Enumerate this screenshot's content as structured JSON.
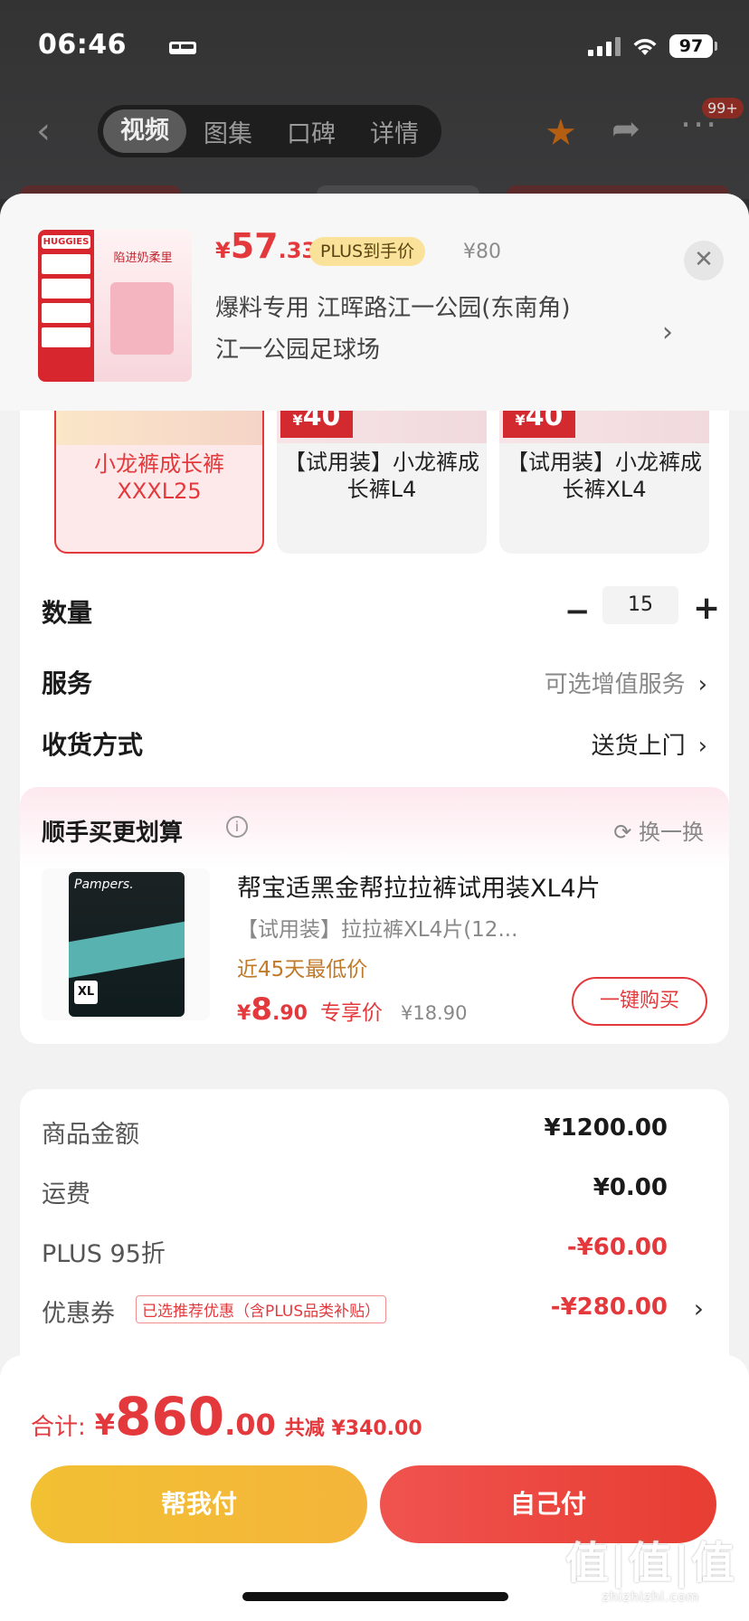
{
  "status": {
    "time": "06:46",
    "battery": "97"
  },
  "nav": {
    "back": "‹",
    "tabs": [
      "视频",
      "图集",
      "口碑",
      "详情"
    ],
    "active_tab": 0,
    "badge": "99+"
  },
  "product": {
    "price_yen": "¥",
    "price_int": "57",
    "price_dec": ".33",
    "plus_label": "PLUS到手价",
    "old_price": "¥80",
    "address_line1": "爆料专用  江晖路江一公园(东南角)",
    "address_line2": "江一公园足球场",
    "thumb_text": "陷进奶柔里",
    "thumb_brand": "HUGGIES"
  },
  "variants": [
    {
      "name": "小龙裤成长裤XXXL25",
      "tag": "",
      "selected": true
    },
    {
      "name": "【试用装】小龙裤成长裤L4",
      "tag": "40",
      "selected": false
    },
    {
      "name": "【试用装】小龙裤成长裤XL4",
      "tag": "40",
      "selected": false
    }
  ],
  "rows": {
    "quantity_label": "数量",
    "quantity_value": "15",
    "service_label": "服务",
    "service_value": "可选增值服务",
    "delivery_label": "收货方式",
    "delivery_value": "送货上门"
  },
  "recommend": {
    "title": "顺手买更划算",
    "swap": "换一换",
    "item_title": "帮宝适黑金帮拉拉裤试用装XL4片",
    "item_sub": "【试用装】拉拉裤XL4片(12...",
    "item_low": "近45天最低价",
    "price_yen": "¥",
    "price_int": "8",
    "price_dec": ".90",
    "price_tag": "专享价",
    "old_price": "¥18.90",
    "buy_label": "一键购买",
    "img_brand": "Pampers.",
    "img_size": "XL"
  },
  "summary": {
    "goods_label": "商品金额",
    "goods_value": "¥1200.00",
    "freight_label": "运费",
    "freight_value": "¥0.00",
    "plus_label": "PLUS 95折",
    "plus_value": "-¥60.00",
    "coupon_label": "优惠券",
    "coupon_tag": "已选推荐优惠（含PLUS品类补贴）",
    "coupon_value": "-¥280.00"
  },
  "bottom": {
    "total_label": "合计:",
    "yen": "¥",
    "total_int": "860",
    "total_dec": ".00",
    "saved": "共减 ¥340.00",
    "help_pay": "帮我付",
    "self_pay": "自己付"
  },
  "watermark": {
    "main": "值|值|值",
    "sub": "zhizhizhi.com"
  },
  "colors": {
    "accent": "#e4393c",
    "plus_badge": "#fbe29a",
    "help_btn": "#f2c033",
    "self_btn": "#e9443a"
  }
}
